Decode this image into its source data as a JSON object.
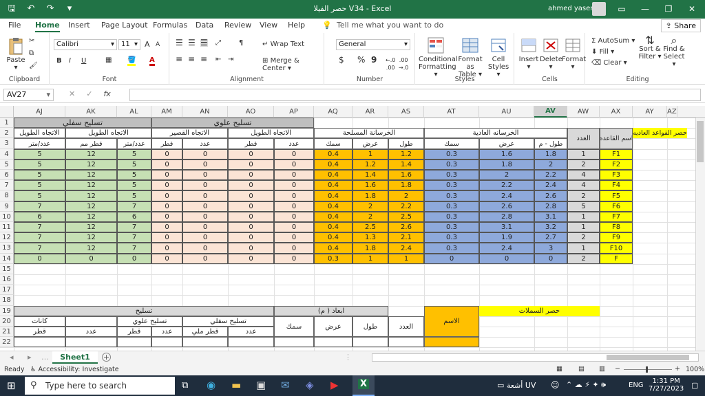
{
  "window": {
    "title": "حصر الفيلا V34  -  Excel",
    "user": "ahmed yaser",
    "save_icon": "save-icon",
    "undo_icon": "undo-icon",
    "redo_icon": "redo-icon",
    "customize_icon": "customize-qat-icon",
    "ribbon_options": "ribbon-display-options-icon",
    "minimize": "minimize-icon",
    "restore": "restore-icon",
    "close": "close-icon"
  },
  "menu": {
    "tabs": [
      "File",
      "Home",
      "Insert",
      "Page Layout",
      "Formulas",
      "Data",
      "Review",
      "View",
      "Help"
    ],
    "active": "Home",
    "tell_me": "Tell me what you want to do",
    "share": "Share"
  },
  "ribbon": {
    "clipboard": {
      "paste": "Paste",
      "label": "Clipboard"
    },
    "font": {
      "name": "Calibri",
      "size": "11",
      "label": "Font",
      "bold": "B",
      "italic": "I",
      "underline": "U",
      "grow": "A",
      "shrink": "A"
    },
    "alignment": {
      "wrap": "Wrap Text",
      "merge": "Merge & Center",
      "label": "Alignment"
    },
    "number": {
      "format": "General",
      "currency": "$",
      "percent": "%",
      "comma": "9",
      "label": "Number"
    },
    "styles": {
      "cond": "Conditional",
      "cond2": "Formatting",
      "fmt_table": "Format as",
      "fmt_table2": "Table",
      "cell_styles": "Cell",
      "cell_styles2": "Styles",
      "label": "Styles"
    },
    "cells": {
      "insert": "Insert",
      "delete": "Delete",
      "format": "Format",
      "label": "Cells"
    },
    "editing": {
      "autosum": "AutoSum",
      "fill": "Fill",
      "clear": "Clear",
      "sort": "Sort &",
      "sort2": "Filter",
      "find": "Find &",
      "find2": "Select",
      "label": "Editing"
    }
  },
  "formula_bar": {
    "name_box": "AV27",
    "cancel": "✕",
    "enter": "✓",
    "fx": "fx",
    "value": ""
  },
  "columns": [
    "AJ",
    "AK",
    "AL",
    "AM",
    "AN",
    "AO",
    "AP",
    "AQ",
    "AR",
    "AS",
    "AT",
    "AU",
    "AV",
    "AW",
    "AX",
    "AY",
    "AZ"
  ],
  "selected_column": "AV",
  "rows": [
    "1",
    "2",
    "3",
    "4",
    "5",
    "6",
    "7",
    "8",
    "9",
    "10",
    "11",
    "12",
    "13",
    "14",
    "15",
    "16",
    "17",
    "18",
    "19",
    "20",
    "21",
    "22"
  ],
  "headers": {
    "bottom_reinf": "تسليح سفلي",
    "top_reinf": "تسليح علوي",
    "long_dir": "الاتجاه الطويل",
    "short_dir": "الاتجاه القصير",
    "long_dir2": "الاتجاه الطويل",
    "long_dir3": "الاتجاه الطويل",
    "rc_concrete": "الخرسانة المسلحة",
    "plain_concrete": "الخرسانه العادية",
    "count": "العدد",
    "footing_name": "اسم القاعده",
    "footing_summary": "حصر القواعد العاديه",
    "aj3": "عدد/متر",
    "ak3": "قطر مم",
    "al3": "عدد/متر",
    "am3": "قطر",
    "an3": "عدد",
    "ao3": "قطر",
    "ap3": "عدد",
    "aq3": "سمك",
    "ar3": "عرض",
    "as3": "طول",
    "at3": "سمك",
    "au3": "عرض",
    "av3": "طول - م"
  },
  "table_rows": [
    [
      "5",
      "12",
      "5",
      "0",
      "0",
      "0",
      "0",
      "0.4",
      "1",
      "1.2",
      "0.3",
      "1.6",
      "1.8",
      "1",
      "F1"
    ],
    [
      "5",
      "12",
      "5",
      "0",
      "0",
      "0",
      "0",
      "0.4",
      "1.2",
      "1.4",
      "0.3",
      "1.8",
      "2",
      "2",
      "F2"
    ],
    [
      "5",
      "12",
      "5",
      "0",
      "0",
      "0",
      "0",
      "0.4",
      "1.4",
      "1.6",
      "0.3",
      "2",
      "2.2",
      "4",
      "F3"
    ],
    [
      "5",
      "12",
      "5",
      "0",
      "0",
      "0",
      "0",
      "0.4",
      "1.6",
      "1.8",
      "0.3",
      "2.2",
      "2.4",
      "4",
      "F4"
    ],
    [
      "5",
      "12",
      "5",
      "0",
      "0",
      "0",
      "0",
      "0.4",
      "1.8",
      "2",
      "0.3",
      "2.4",
      "2.6",
      "2",
      "F5"
    ],
    [
      "7",
      "12",
      "7",
      "0",
      "0",
      "0",
      "0",
      "0.4",
      "2",
      "2.2",
      "0.3",
      "2.6",
      "2.8",
      "5",
      "F6"
    ],
    [
      "6",
      "12",
      "6",
      "0",
      "0",
      "0",
      "0",
      "0.4",
      "2",
      "2.5",
      "0.3",
      "2.8",
      "3.1",
      "1",
      "F7"
    ],
    [
      "7",
      "12",
      "7",
      "0",
      "0",
      "0",
      "0",
      "0.4",
      "2.5",
      "2.6",
      "0.3",
      "3.1",
      "3.2",
      "1",
      "F8"
    ],
    [
      "7",
      "12",
      "7",
      "0",
      "0",
      "0",
      "0",
      "0.4",
      "1.3",
      "2.1",
      "0.3",
      "1.9",
      "2.7",
      "2",
      "F9"
    ],
    [
      "7",
      "12",
      "7",
      "0",
      "0",
      "0",
      "0",
      "0.4",
      "1.8",
      "2.4",
      "0.3",
      "2.4",
      "3",
      "1",
      "F10"
    ],
    [
      "0",
      "0",
      "0",
      "0",
      "0",
      "0",
      "0",
      "0.3",
      "1",
      "1",
      "0",
      "0",
      "0",
      "2",
      "F"
    ]
  ],
  "lower": {
    "reinf": "تسليح",
    "dims": "ابعاد ( م)",
    "columns_summary": "حصر السملات",
    "r20_aj": "كانات",
    "r20_top": "تسليح علوي",
    "r20_bottom": "تسليح سفلي",
    "r20_thick": "سمك",
    "r20_width": "عرض",
    "r20_length": "طول",
    "r20_count": "العدد",
    "r20_name": "الاسم",
    "r21_aj": "قطر",
    "r21_al": "عدد",
    "r21_am": "قطر",
    "r21_an": "عدد",
    "r21_ao": "قطر ملي",
    "r21_ap": "عدد"
  },
  "sheet": {
    "tab": "Sheet1",
    "add": "+"
  },
  "status": {
    "ready": "Ready",
    "accessibility": "Accessibility: Investigate",
    "zoom": "100%"
  },
  "taskbar": {
    "search": "Type here to search",
    "weather": "أشعة UV",
    "lang": "ENG",
    "time": "1:31 PM",
    "date": "7/27/2023"
  },
  "colors": {
    "excel_green": "#217346",
    "header_gray": "#bfbfbf",
    "pink": "#fbe4d5",
    "green": "#c6e0b4",
    "orange": "#ffc000",
    "blue": "#8ea9db",
    "yellow": "#ffff00",
    "light_gray": "#d9d9d9"
  }
}
